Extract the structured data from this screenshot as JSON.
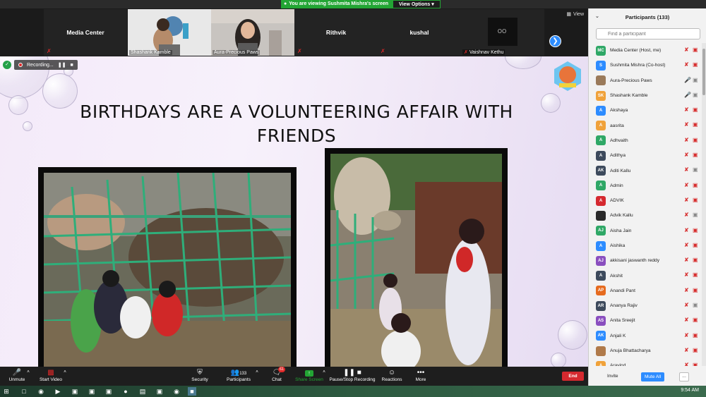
{
  "banner": {
    "viewing_text": "You are viewing Sushmita Mishra's screen",
    "view_options": "View Options"
  },
  "strip": {
    "view_label": "View",
    "tiles": [
      {
        "name": "Media Center",
        "kind": "name"
      },
      {
        "name": "Shashank Kamble",
        "kind": "video"
      },
      {
        "name": "Aura-Precious Paws",
        "kind": "video"
      },
      {
        "name": "Rithvik",
        "kind": "name"
      },
      {
        "name": "kushal",
        "kind": "name"
      },
      {
        "name": "Vaishnav Kethu",
        "kind": "video"
      }
    ]
  },
  "recording": {
    "label": "Recording..."
  },
  "slide": {
    "title_line1": "BIRTHDAYS ARE A VOLUNTEERING AFFAIR WITH",
    "title_line2": "FRIENDS"
  },
  "toolbar": {
    "unmute": "Unmute",
    "start_video": "Start Video",
    "security": "Security",
    "participants": "Participants",
    "participant_count": "133",
    "chat": "Chat",
    "chat_badge": "61",
    "share_screen": "Share Screen",
    "pause_recording": "Pause/Stop Recording",
    "reactions": "Reactions",
    "more": "More",
    "end": "End"
  },
  "panel": {
    "title": "Participants (133)",
    "search_placeholder": "Find a participant",
    "invite": "Invite",
    "mute_all": "Mute All",
    "more": "...",
    "participants": [
      {
        "initials": "MC",
        "name": "Media Center (Host, me)",
        "color": "#2fa866",
        "mic": "muted",
        "cam": "off"
      },
      {
        "initials": "S",
        "name": "Sushmita Mishra (Co-host)",
        "color": "#2d8cff",
        "mic": "muted",
        "cam": "off"
      },
      {
        "initials": "",
        "name": "Aura-Precious Paws",
        "color": "#9a7a5a",
        "mic": "on",
        "cam": "on"
      },
      {
        "initials": "SK",
        "name": "Shashank Kamble",
        "color": "#f0a23a",
        "mic": "on",
        "cam": "on"
      },
      {
        "initials": "A",
        "name": " Akshaya",
        "color": "#2d8cff",
        "mic": "muted",
        "cam": "off"
      },
      {
        "initials": "A",
        "name": "aasrita",
        "color": "#f0a23a",
        "mic": "muted",
        "cam": "off"
      },
      {
        "initials": "A",
        "name": "Adhvaith",
        "color": "#2fa866",
        "mic": "muted",
        "cam": "off"
      },
      {
        "initials": "A",
        "name": "Adithya",
        "color": "#3d4a5c",
        "mic": "muted",
        "cam": "off"
      },
      {
        "initials": "AK",
        "name": "Aditi Kallu",
        "color": "#3d4a5c",
        "mic": "muted",
        "cam": "on"
      },
      {
        "initials": "A",
        "name": "Admin",
        "color": "#2fa866",
        "mic": "muted",
        "cam": "off"
      },
      {
        "initials": "A",
        "name": "ADVIK",
        "color": "#d5292f",
        "mic": "muted",
        "cam": "off"
      },
      {
        "initials": "",
        "name": "Advik Kallu",
        "color": "#2a2a2a",
        "mic": "muted",
        "cam": "on"
      },
      {
        "initials": "AJ",
        "name": "Aisha Jain",
        "color": "#2fa866",
        "mic": "muted",
        "cam": "off"
      },
      {
        "initials": "A",
        "name": "Aishika",
        "color": "#2d8cff",
        "mic": "muted",
        "cam": "off"
      },
      {
        "initials": "AJ",
        "name": "akkisani jaswanth reddy",
        "color": "#8a4fbf",
        "mic": "muted",
        "cam": "off"
      },
      {
        "initials": "A",
        "name": "Akshit",
        "color": "#3d4a5c",
        "mic": "muted",
        "cam": "off"
      },
      {
        "initials": "AP",
        "name": "Anandi Pant",
        "color": "#e66b1f",
        "mic": "muted",
        "cam": "off"
      },
      {
        "initials": "AR",
        "name": "Ananya Rajiv",
        "color": "#3d4a5c",
        "mic": "muted",
        "cam": "on"
      },
      {
        "initials": "AS",
        "name": "Anita Sreejit",
        "color": "#8a4fbf",
        "mic": "muted",
        "cam": "off"
      },
      {
        "initials": "AK",
        "name": "Anjali K",
        "color": "#2d8cff",
        "mic": "muted",
        "cam": "off"
      },
      {
        "initials": "",
        "name": "Anuja Bhattacharya",
        "color": "#b07a4a",
        "mic": "muted",
        "cam": "off"
      },
      {
        "initials": "A",
        "name": "Aravind",
        "color": "#f0a23a",
        "mic": "muted",
        "cam": "off"
      }
    ]
  },
  "taskbar": {
    "time": "9:54 AM"
  }
}
